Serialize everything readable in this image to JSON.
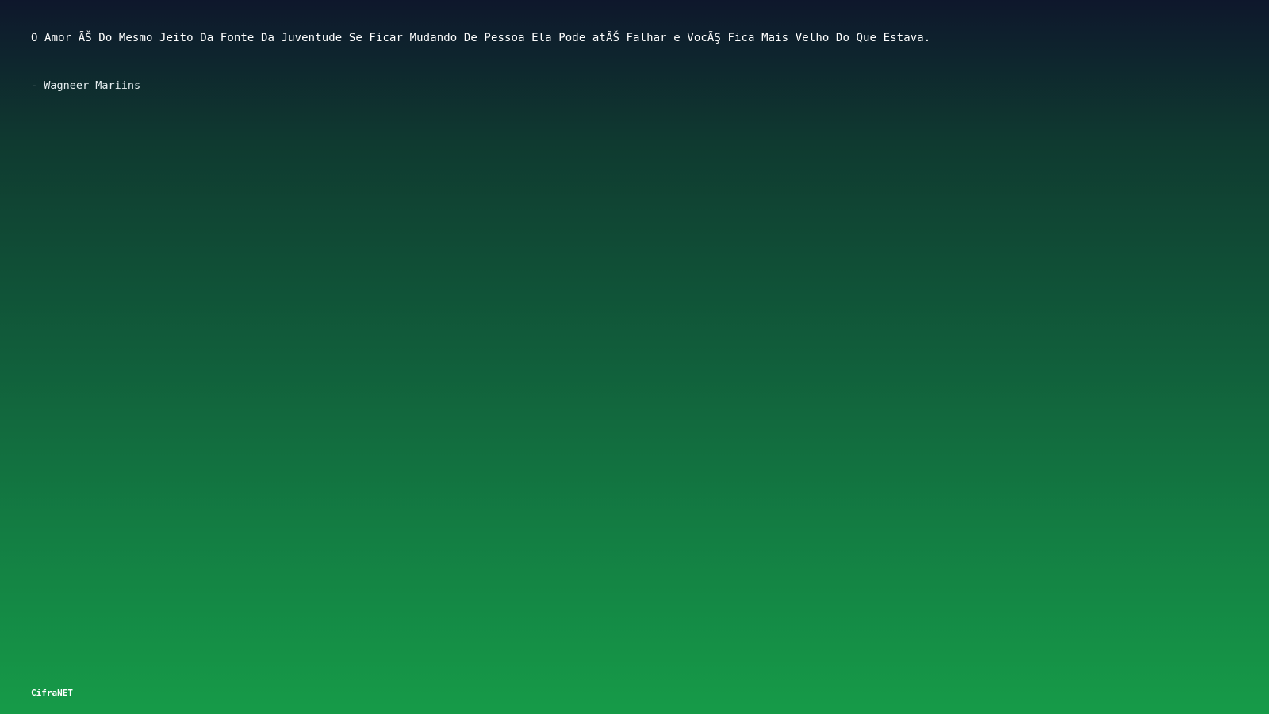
{
  "quote": {
    "text": "O Amor ÃŠ Do Mesmo Jeito Da Fonte Da Juventude Se Ficar Mudando De Pessoa Ela Pode atÃŠ Falhar e VocÃŞ Fica Mais Velho Do Que Estava.",
    "author": "- Wagneer Mariins"
  },
  "footer": {
    "brand": "CifraNET"
  },
  "colors": {
    "gradient_top": "#0e172c",
    "gradient_bottom": "#169b48",
    "text": "#ffffff"
  }
}
